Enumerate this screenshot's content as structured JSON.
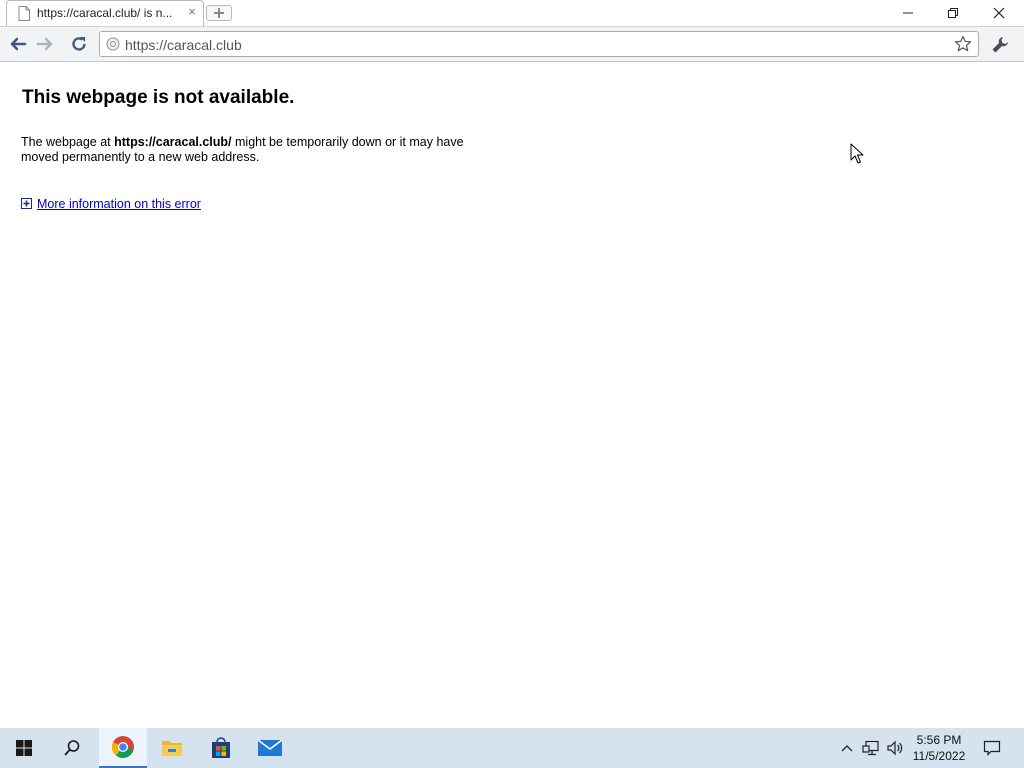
{
  "browser": {
    "tab": {
      "title": "https://caracal.club/ is n...",
      "close_glyph": "×",
      "icon": "document-icon"
    },
    "window_controls": [
      "minimize-icon",
      "restore-icon",
      "close-icon"
    ],
    "toolbar": {
      "back_icon": "back-arrow-icon",
      "forward_icon": "forward-arrow-icon",
      "reload_icon": "reload-icon",
      "address": "https://caracal.club",
      "bookmark_icon": "star-icon",
      "menu_icon": "wrench-icon"
    }
  },
  "error_page": {
    "title": "This webpage is not available.",
    "body_prefix": "The webpage at ",
    "url_bold": "https://caracal.club/",
    "body_suffix": " might be temporarily down or it may have moved permanently to a new web address.",
    "more_info_link": "More information on this error"
  },
  "taskbar": {
    "items": [
      "windows-start-icon",
      "search-icon",
      "chrome-icon",
      "file-explorer-icon",
      "store-icon",
      "mail-icon"
    ],
    "tray": [
      "chevron-up-icon",
      "network-icon",
      "volume-icon"
    ],
    "clock": {
      "time": "5:56 PM",
      "date": "11/5/2022"
    },
    "notifications_icon": "notification-icon"
  },
  "colors": {
    "link": "#0000cc",
    "taskbar": "#d5e3f0",
    "toolbar": "#f2f3f5"
  }
}
